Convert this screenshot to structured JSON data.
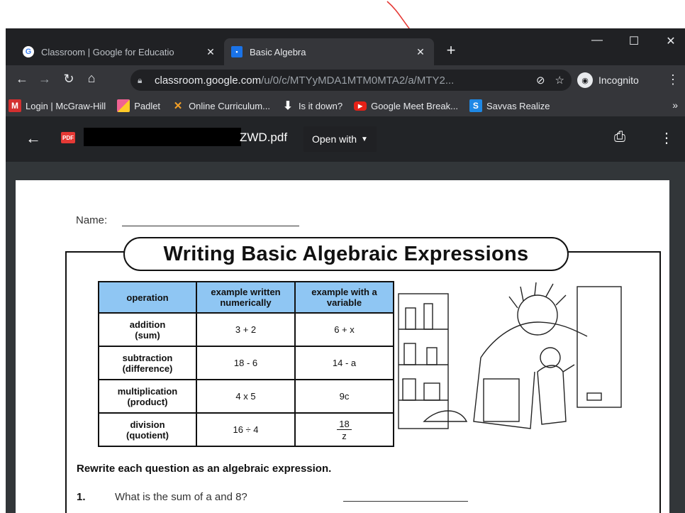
{
  "browser": {
    "tabs": [
      {
        "title": "Classroom | Google for Educatio",
        "close": "✕",
        "active": false
      },
      {
        "title": "Basic Algebra",
        "close": "✕",
        "active": true
      }
    ],
    "new_tab": "+",
    "window_controls": {
      "minimize": "—",
      "maximize": "☐",
      "close": "✕"
    },
    "url_host": "classroom.google.com",
    "url_path": "/u/0/c/MTYyMDA1MTM0MTA2/a/MTY2...",
    "incognito_label": "Incognito",
    "bookmarks": [
      {
        "label": "Login | McGraw-Hill",
        "icon": "M",
        "color": "#d32f2f"
      },
      {
        "label": "Padlet",
        "icon": "padlet-icon",
        "color": "#f06292"
      },
      {
        "label": "Online Curriculum...",
        "icon": "✕",
        "color": "#f4a027"
      },
      {
        "label": "Is it down?",
        "icon": "arrow-down-icon",
        "color": "#ffffff"
      },
      {
        "label": "Google Meet Break...",
        "icon": "youtube-icon",
        "color": "#e62117"
      },
      {
        "label": "Savvas Realize",
        "icon": "S",
        "color": "#1e88e5"
      }
    ],
    "bookmarks_more": "»"
  },
  "viewer": {
    "file_name": "ZWD.pdf",
    "pdf_badge": "PDF",
    "open_with": "Open with"
  },
  "worksheet": {
    "name_label": "Name:",
    "title": "Writing Basic Algebraic Expressions",
    "headers": [
      "operation",
      "example written numerically",
      "example with a variable"
    ],
    "rows": [
      {
        "op": "addition",
        "op_sub": "(sum)",
        "numeric": "3 + 2",
        "variable": "6 + x"
      },
      {
        "op": "subtraction",
        "op_sub": "(difference)",
        "numeric": "18 - 6",
        "variable": "14 - a"
      },
      {
        "op": "multiplication",
        "op_sub": "(product)",
        "numeric": "4 x 5",
        "variable": "9c"
      },
      {
        "op": "division",
        "op_sub": "(quotient)",
        "numeric": "16 ÷ 4",
        "variable_num": "18",
        "variable_den": "z"
      }
    ],
    "instruction": "Rewrite each question as an algebraic expression.",
    "q1_number": "1.",
    "q1_text": "What is the sum of a and 8?"
  }
}
